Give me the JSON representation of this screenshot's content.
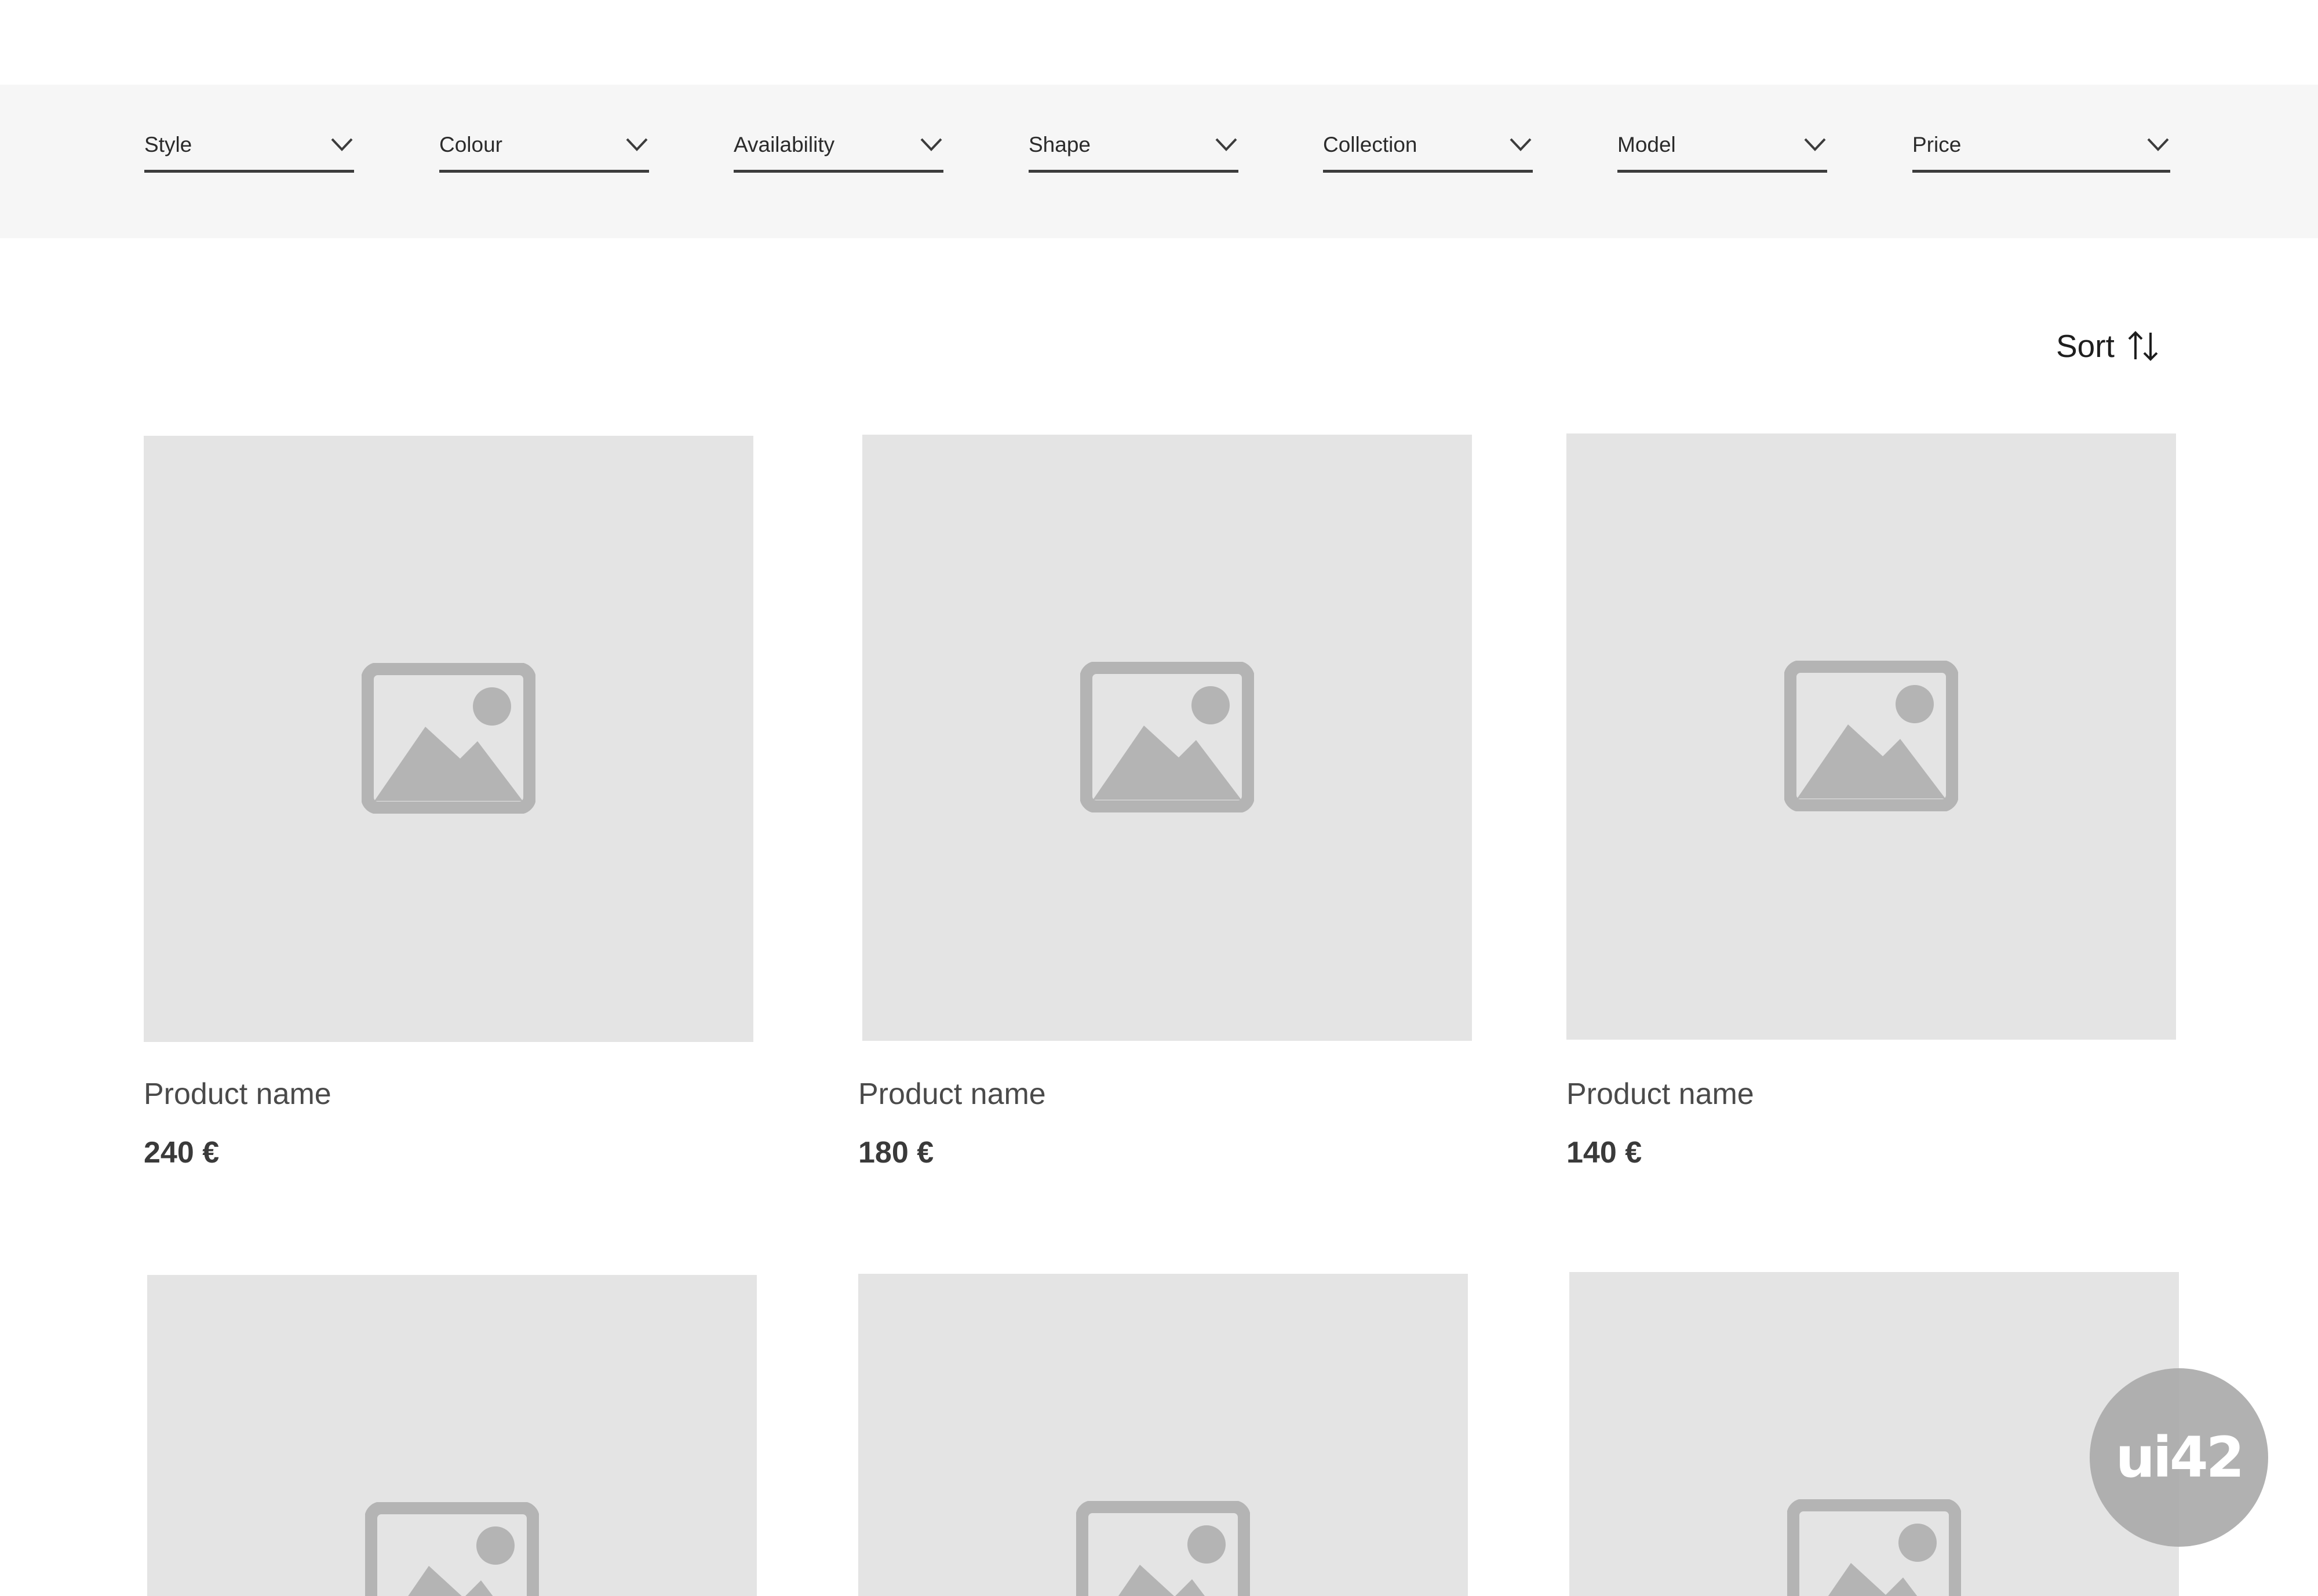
{
  "filters": [
    {
      "label": "Style"
    },
    {
      "label": "Colour"
    },
    {
      "label": "Availability"
    },
    {
      "label": "Shape"
    },
    {
      "label": "Collection"
    },
    {
      "label": "Model"
    },
    {
      "label": "Price"
    }
  ],
  "sort": {
    "label": "Sort",
    "icon": "sort-arrows-icon"
  },
  "products": [
    {
      "name": "Product name",
      "price": "240 €"
    },
    {
      "name": "Product name",
      "price": "180 €"
    },
    {
      "name": "Product name",
      "price": "140 €"
    },
    {
      "name": "",
      "price": ""
    },
    {
      "name": "",
      "price": ""
    },
    {
      "name": "",
      "price": ""
    }
  ],
  "logo": {
    "text": "ui42"
  },
  "colors": {
    "filter_bar_bg": "#f6f6f6",
    "image_placeholder_bg": "#e4e4e4",
    "placeholder_icon": "#b4b4b4",
    "text_dark": "#2b2b2b"
  }
}
